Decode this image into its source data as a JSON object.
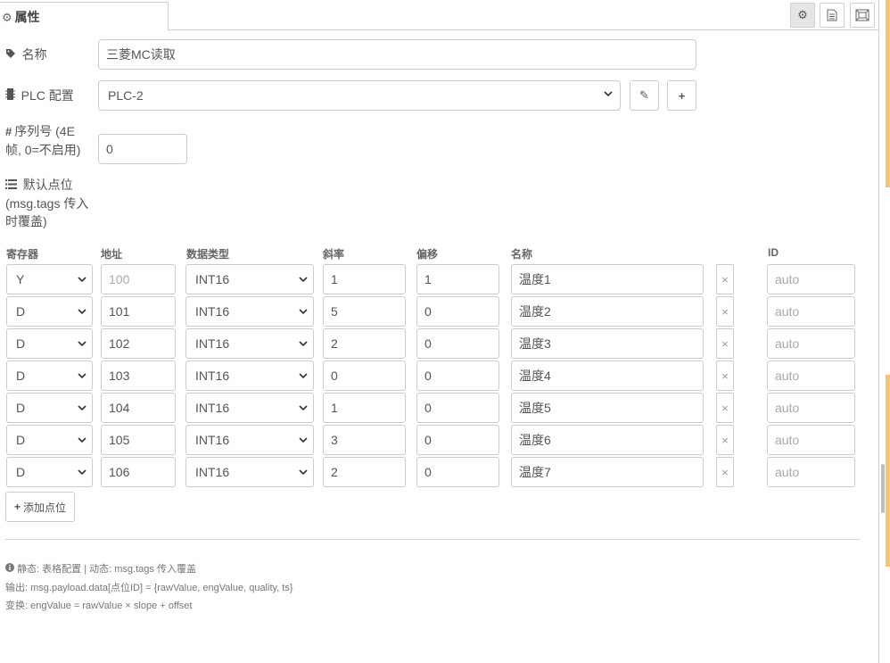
{
  "header": {
    "tab_label": "属性",
    "buttons": [
      "gear-icon",
      "document-icon",
      "expand-icon"
    ]
  },
  "form": {
    "name_label": "名称",
    "name_value": "三菱MC读取",
    "plc_label": "PLC 配置",
    "plc_value": "PLC-2",
    "serial_label_1": "序列号 (4E",
    "serial_label_2": "帧, 0=不启用)",
    "serial_value": "0",
    "default_label_1": "默认点位",
    "default_label_2": "(msg.tags 传入",
    "default_label_3": "时覆盖)"
  },
  "table": {
    "headers": [
      "寄存器",
      "地址",
      "数据类型",
      "斜率",
      "偏移",
      "名称",
      "ID"
    ],
    "id_placeholder": "auto",
    "address_placeholder": "100",
    "rows": [
      {
        "register": "Y",
        "address": "",
        "type": "INT16",
        "slope": "1",
        "offset": "1",
        "name": "温度1"
      },
      {
        "register": "D",
        "address": "101",
        "type": "INT16",
        "slope": "5",
        "offset": "0",
        "name": "温度2"
      },
      {
        "register": "D",
        "address": "102",
        "type": "INT16",
        "slope": "2",
        "offset": "0",
        "name": "温度3"
      },
      {
        "register": "D",
        "address": "103",
        "type": "INT16",
        "slope": "0",
        "offset": "0",
        "name": "温度4"
      },
      {
        "register": "D",
        "address": "104",
        "type": "INT16",
        "slope": "1",
        "offset": "0",
        "name": "温度5"
      },
      {
        "register": "D",
        "address": "105",
        "type": "INT16",
        "slope": "3",
        "offset": "0",
        "name": "温度6"
      },
      {
        "register": "D",
        "address": "106",
        "type": "INT16",
        "slope": "2",
        "offset": "0",
        "name": "温度7"
      }
    ],
    "add_label": "添加点位"
  },
  "notes": {
    "line1": "静态: 表格配置 | 动态: msg.tags 传入覆盖",
    "line2": "输出: msg.payload.data[点位ID] = {rawValue, engValue, quality, ts}",
    "line3": "变换: engValue = rawValue × slope + offset"
  },
  "colors": {
    "accent_scroll": "#f6c46a",
    "border": "#cccccc"
  }
}
